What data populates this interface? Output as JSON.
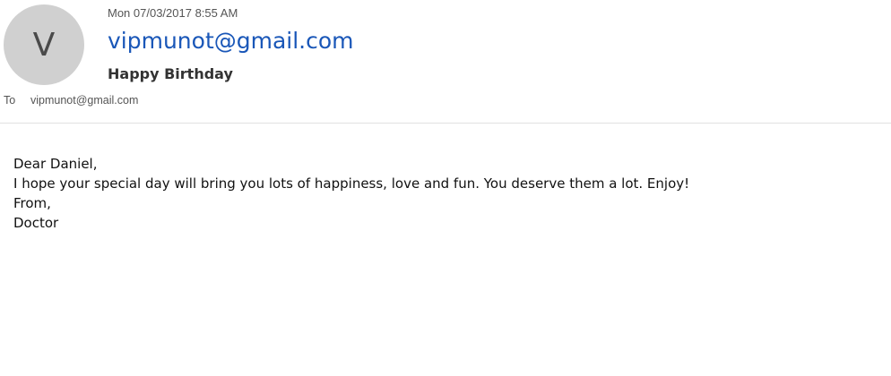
{
  "header": {
    "avatar_letter": "V",
    "date": "Mon 07/03/2017 8:55 AM",
    "sender": "vipmunot@gmail.com",
    "subject": "Happy Birthday",
    "to_label": "To",
    "to_value": "vipmunot@gmail.com"
  },
  "body": {
    "lines": [
      "Dear Daniel,",
      "I hope your special day will bring you lots of happiness, love and fun. You deserve them a lot. Enjoy!",
      "From,",
      "Doctor"
    ]
  },
  "colors": {
    "sender_link": "#1a57b8",
    "avatar_bg": "#d0d0d0",
    "divider": "#e1e1e1"
  }
}
